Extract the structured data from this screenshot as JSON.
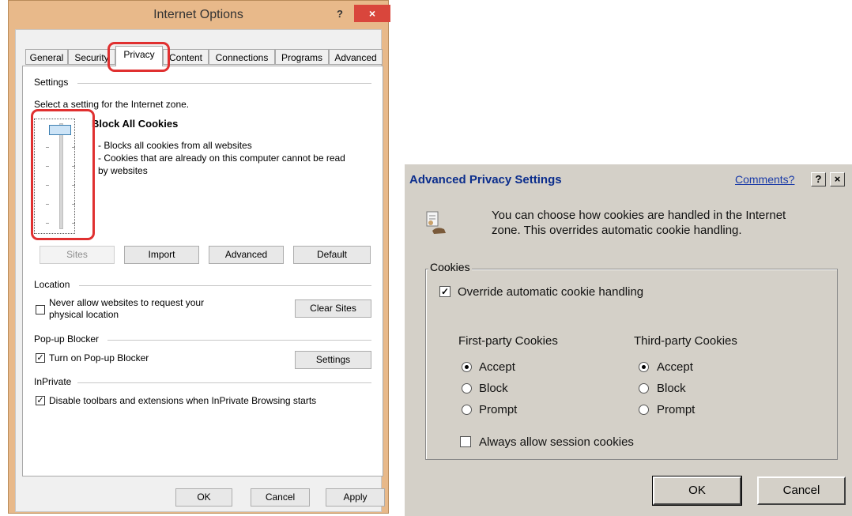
{
  "internet_options": {
    "title": "Internet Options",
    "help": "?",
    "close": "×",
    "tabs": [
      "General",
      "Security",
      "Privacy",
      "Content",
      "Connections",
      "Programs",
      "Advanced"
    ],
    "settings": {
      "group": "Settings",
      "select_text": "Select a setting for the Internet zone.",
      "level_title": "Block All Cookies",
      "desc": [
        "- Blocks all cookies from all websites",
        "- Cookies that are already on this computer cannot be read",
        "by websites"
      ],
      "buttons": {
        "sites": "Sites",
        "import": "Import",
        "advanced": "Advanced",
        "default": "Default"
      }
    },
    "location": {
      "group": "Location",
      "never_allow_line1": "Never allow websites to request your",
      "never_allow_line2": "physical location",
      "clear_sites": "Clear Sites"
    },
    "popup": {
      "group": "Pop-up Blocker",
      "turn_on": "Turn on Pop-up Blocker",
      "settings": "Settings"
    },
    "inprivate": {
      "group": "InPrivate",
      "disable": "Disable toolbars and extensions when InPrivate Browsing starts"
    },
    "footer": {
      "ok": "OK",
      "cancel": "Cancel",
      "apply": "Apply"
    }
  },
  "advanced_privacy": {
    "title": "Advanced Privacy Settings",
    "comments": "Comments?",
    "help": "?",
    "close": "×",
    "intro_line1": "You can choose how cookies are handled in the Internet",
    "intro_line2": "zone.  This overrides automatic cookie handling.",
    "cookies_group": "Cookies",
    "override": "Override automatic cookie handling",
    "first_party": {
      "heading": "First-party Cookies",
      "options": [
        "Accept",
        "Block",
        "Prompt"
      ]
    },
    "third_party": {
      "heading": "Third-party Cookies",
      "options": [
        "Accept",
        "Block",
        "Prompt"
      ]
    },
    "session": "Always allow session cookies",
    "ok": "OK",
    "cancel": "Cancel"
  }
}
